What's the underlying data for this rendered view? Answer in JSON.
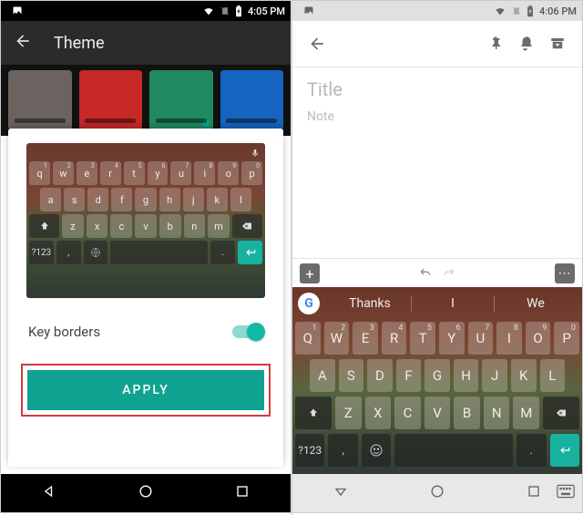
{
  "left": {
    "status_time": "4:05 PM",
    "appbar_title": "Theme",
    "gallery": [
      {
        "color": "#6b6360"
      },
      {
        "color": "#c62828"
      },
      {
        "color": "#1f8a5f",
        "selected": true
      },
      {
        "color": "#1565c0"
      }
    ],
    "row2": [
      {
        "color": "#0e8aa6"
      },
      {
        "color": "#3b7aa3"
      },
      {
        "color": "#3d7e5d"
      },
      {
        "color": "#55452e"
      }
    ],
    "keyboard": {
      "row1": [
        [
          "q",
          "1"
        ],
        [
          "w",
          "2"
        ],
        [
          "e",
          "3"
        ],
        [
          "r",
          "4"
        ],
        [
          "t",
          "5"
        ],
        [
          "y",
          "6"
        ],
        [
          "u",
          "7"
        ],
        [
          "i",
          "8"
        ],
        [
          "o",
          "9"
        ],
        [
          "p",
          "0"
        ]
      ],
      "row2": [
        "a",
        "s",
        "d",
        "f",
        "g",
        "h",
        "j",
        "k",
        "l"
      ],
      "row3": [
        "z",
        "x",
        "c",
        "v",
        "b",
        "n",
        "m"
      ],
      "fn_numbers": "?123",
      "fn_comma": ",",
      "fn_period": "."
    },
    "toggle_label": "Key borders",
    "toggle_on": true,
    "apply_label": "APPLY"
  },
  "right": {
    "status_time": "4:06 PM",
    "title_placeholder": "Title",
    "note_placeholder": "Note",
    "suggestions": [
      "Thanks",
      "I",
      "We"
    ],
    "keyboard": {
      "row1": [
        [
          "Q",
          "1"
        ],
        [
          "W",
          "2"
        ],
        [
          "E",
          "3"
        ],
        [
          "R",
          "4"
        ],
        [
          "T",
          "5"
        ],
        [
          "Y",
          "6"
        ],
        [
          "U",
          "7"
        ],
        [
          "I",
          "8"
        ],
        [
          "O",
          "9"
        ],
        [
          "P",
          "0"
        ]
      ],
      "row2": [
        "A",
        "S",
        "D",
        "F",
        "G",
        "H",
        "J",
        "K",
        "L"
      ],
      "row3": [
        "Z",
        "X",
        "C",
        "V",
        "B",
        "N",
        "M"
      ],
      "fn_numbers": "?123",
      "fn_comma": ",",
      "fn_period": "."
    }
  }
}
